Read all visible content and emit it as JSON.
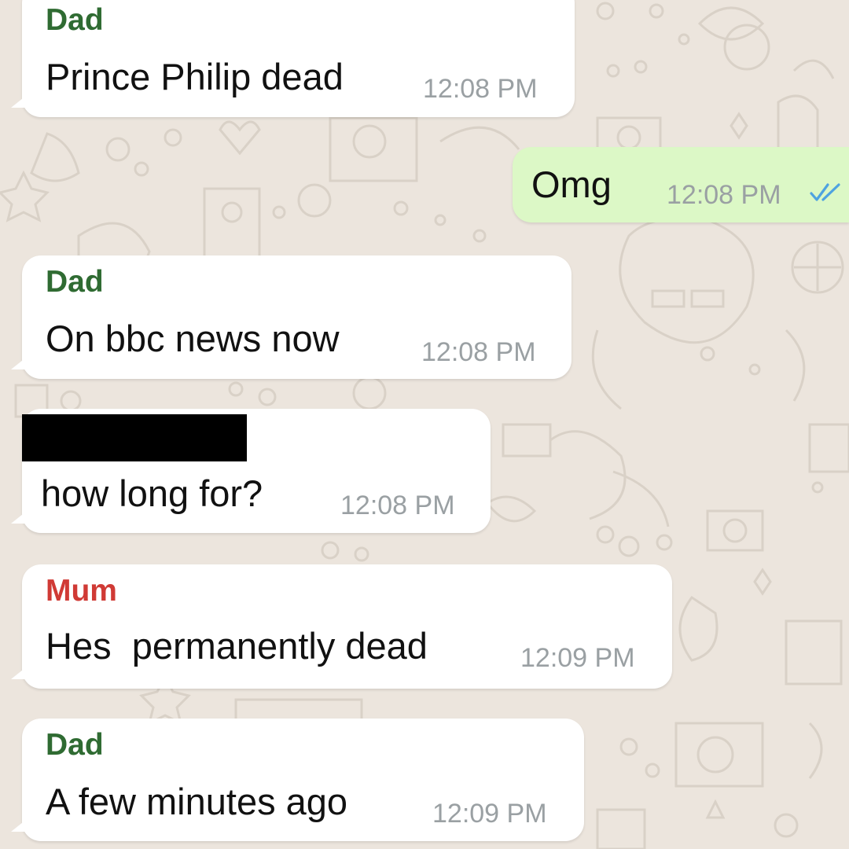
{
  "messages": [
    {
      "sender": "Dad",
      "text": "Prince Philip dead",
      "time": "12:08 PM",
      "direction": "incoming"
    },
    {
      "text": "Omg",
      "time": "12:08 PM",
      "direction": "outgoing",
      "status_icon": "double-check-read-icon"
    },
    {
      "sender": "Dad",
      "text": "On bbc news now",
      "time": "12:08 PM",
      "direction": "incoming"
    },
    {
      "sender_redacted": true,
      "text": "how long for?",
      "time": "12:08 PM",
      "direction": "incoming"
    },
    {
      "sender": "Mum",
      "text": "Hes  permanently dead",
      "time": "12:09 PM",
      "direction": "incoming"
    },
    {
      "sender": "Dad",
      "text": "A few minutes ago",
      "time": "12:09 PM",
      "direction": "incoming"
    }
  ],
  "colors": {
    "wallpaper": "#ece5dd",
    "incoming_bubble": "#ffffff",
    "outgoing_bubble": "#dcf8c6",
    "sender_dad": "#2f6b32",
    "sender_mum": "#d03a35",
    "timestamp": "#9aa0a3",
    "read_ticks": "#4fa3e0"
  }
}
